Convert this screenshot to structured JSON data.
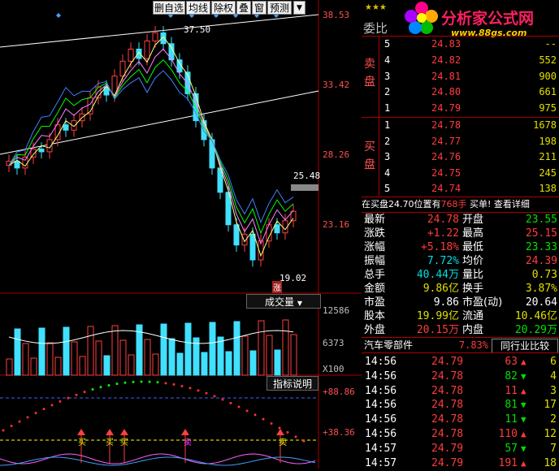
{
  "toolbar": {
    "items": [
      "删自选",
      "均线",
      "除权",
      "叠",
      "窗",
      "预测"
    ],
    "menu_icon": "triangle-down-icon"
  },
  "chart": {
    "price_ticks": [
      "38.53",
      "33.42",
      "28.26",
      "23.16"
    ],
    "high_label": "37.50",
    "low_label": "19.02",
    "last_tag": "25.48",
    "zhang": "涨",
    "volume_button": "成交量",
    "volume_ticks": [
      "12586",
      "6373"
    ],
    "unit_label": "X100",
    "indicator_button": "指标说明",
    "ind_ticks": [
      "+88.86",
      "+38.36"
    ],
    "signals": [
      "买",
      "买",
      "买",
      "卖",
      "卖"
    ]
  },
  "logo": {
    "title": "分析家公式网",
    "url": "www.88gs.com"
  },
  "quote": {
    "weibi_label": "委比",
    "sell_label": "卖盘",
    "buy_label": "买盘",
    "sell": [
      {
        "n": "5",
        "p": "24.83",
        "v": "--"
      },
      {
        "n": "4",
        "p": "24.82",
        "v": "552"
      },
      {
        "n": "3",
        "p": "24.81",
        "v": "900"
      },
      {
        "n": "2",
        "p": "24.80",
        "v": "661"
      },
      {
        "n": "1",
        "p": "24.79",
        "v": "975"
      }
    ],
    "buy": [
      {
        "n": "1",
        "p": "24.78",
        "v": "1678"
      },
      {
        "n": "2",
        "p": "24.77",
        "v": "198"
      },
      {
        "n": "3",
        "p": "24.76",
        "v": "211"
      },
      {
        "n": "4",
        "p": "24.75",
        "v": "245"
      },
      {
        "n": "5",
        "p": "24.74",
        "v": "138"
      }
    ],
    "notice": {
      "prefix": "在买盘24.70位置有",
      "amount": "768手",
      "suffix": "买单! 查看详细"
    },
    "stats": [
      [
        "最新",
        "24.78",
        "red",
        "开盘",
        "23.55",
        "green"
      ],
      [
        "涨跌",
        "+1.22",
        "red",
        "最高",
        "25.15",
        "red"
      ],
      [
        "涨幅",
        "+5.18%",
        "red",
        "最低",
        "23.33",
        "green"
      ],
      [
        "振幅",
        "7.72%",
        "cyan",
        "均价",
        "24.39",
        "red"
      ],
      [
        "总手",
        "40.44万",
        "cyan",
        "量比",
        "0.73",
        "yel"
      ],
      [
        "金额",
        "9.86亿",
        "yel",
        "换手",
        "3.87%",
        "yel"
      ],
      [
        "市盈",
        "9.86",
        "wht",
        "市盈(动)",
        "20.64",
        "wht"
      ],
      [
        "股本",
        "19.99亿",
        "yel",
        "流通",
        "10.46亿",
        "yel"
      ],
      [
        "外盘",
        "20.15万",
        "red",
        "内盘",
        "20.29万",
        "green"
      ]
    ],
    "sector": {
      "name": "汽车零部件",
      "pct": "7.83%",
      "compare": "同行业比较"
    },
    "ticks": [
      {
        "t": "14:56",
        "p": "24.79",
        "v": "63",
        "dir": "up",
        "n": "6"
      },
      {
        "t": "14:56",
        "p": "24.78",
        "v": "82",
        "dir": "down",
        "n": "4"
      },
      {
        "t": "14:56",
        "p": "24.78",
        "v": "11",
        "dir": "up",
        "n": "3"
      },
      {
        "t": "14:56",
        "p": "24.78",
        "v": "81",
        "dir": "down",
        "n": "17"
      },
      {
        "t": "14:56",
        "p": "24.78",
        "v": "11",
        "dir": "down",
        "n": "2"
      },
      {
        "t": "14:56",
        "p": "24.78",
        "v": "110",
        "dir": "up",
        "n": "12"
      },
      {
        "t": "14:57",
        "p": "24.79",
        "v": "57",
        "dir": "down",
        "n": "7"
      },
      {
        "t": "14:57",
        "p": "24.79",
        "v": "191",
        "dir": "up",
        "n": "18"
      }
    ]
  }
}
